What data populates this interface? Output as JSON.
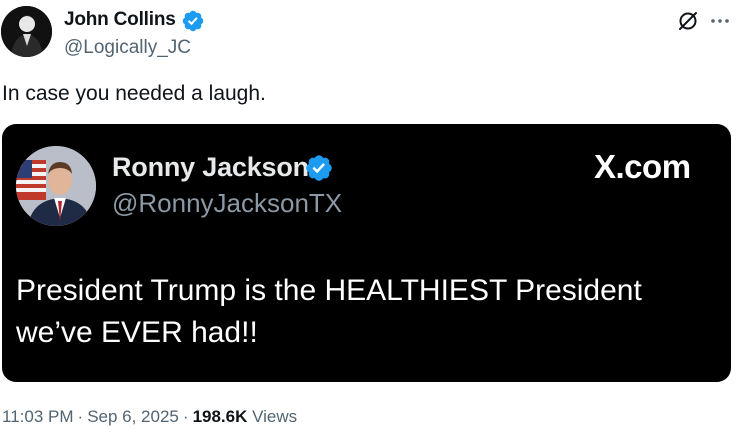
{
  "tweet": {
    "author": {
      "name": "John Collins",
      "handle": "@Logically_JC",
      "verified": true
    },
    "text": "In case you needed a laugh.",
    "timestamp": {
      "time": "11:03 PM",
      "separator": "·",
      "date": "Sep 6, 2025"
    },
    "views": {
      "count": "198.6K",
      "label": "Views"
    },
    "header_icons": [
      "grok-icon",
      "more-icon"
    ]
  },
  "embedded_card": {
    "author": {
      "name": "Ronny Jackson",
      "handle": "@RonnyJacksonTX",
      "verified": true
    },
    "brand": "X.com",
    "text": "President Trump is the HEALTHIEST President we’ve EVER had!!"
  },
  "colors": {
    "verified_blue": "#1d9bf0",
    "secondary_text": "#536471",
    "card_background": "#000000"
  }
}
